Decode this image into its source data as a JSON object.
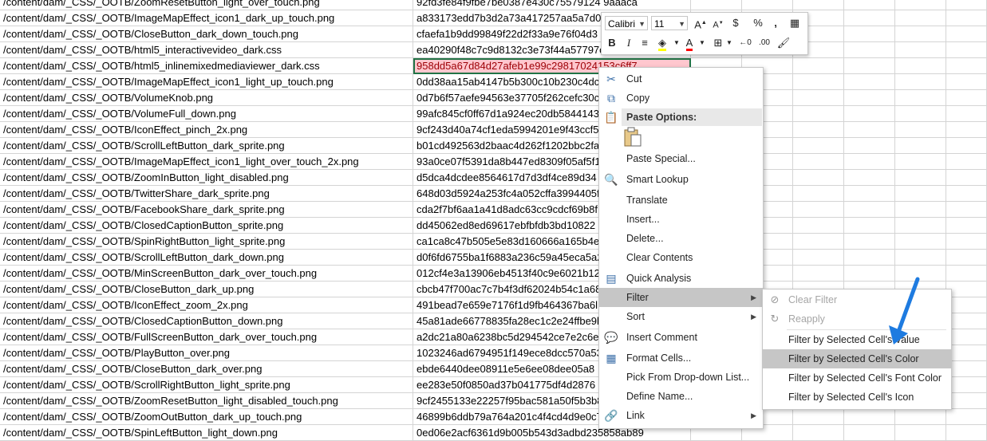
{
  "rows": [
    {
      "path": "/content/dam/_CSS/_OOTB/ZoomResetButton_light_over_touch.png",
      "hash": "92fd3fe84f9fbe7be0387e430c75579124 9aaaca"
    },
    {
      "path": "/content/dam/_CSS/_OOTB/ImageMapEffect_icon1_dark_up_touch.png",
      "hash": "a833173edd7b3d2a73a417257aa5a7d0"
    },
    {
      "path": "/content/dam/_CSS/_OOTB/CloseButton_dark_down_touch.png",
      "hash": "cfaefa1b9dd99849f22d2f33a9e76f04d3"
    },
    {
      "path": "/content/dam/_CSS/_OOTB/html5_interactivevideo_dark.css",
      "hash": "ea40290f48c7c9d8132c3e73f44a57797c"
    },
    {
      "path": "/content/dam/_CSS/_OOTB/html5_inlinemixedmediaviewer_dark.css",
      "hash": "958dd5a67d84d27afeb1e99c29817024153c6ff7"
    },
    {
      "path": "/content/dam/_CSS/_OOTB/ImageMapEffect_icon1_light_up_touch.png",
      "hash": "0dd38aa15ab4147b5b300c10b230c4dc"
    },
    {
      "path": "/content/dam/_CSS/_OOTB/VolumeKnob.png",
      "hash": "0d7b6f57aefe94563e37705f262cefc30c"
    },
    {
      "path": "/content/dam/_CSS/_OOTB/VolumeFull_down.png",
      "hash": "99afc845cf0ff67d1a924ec20db58441437"
    },
    {
      "path": "/content/dam/_CSS/_OOTB/IconEffect_pinch_2x.png",
      "hash": "9cf243d40a74cf1eda5994201e9f43ccf5"
    },
    {
      "path": "/content/dam/_CSS/_OOTB/ScrollLeftButton_dark_sprite.png",
      "hash": "b01cd492563d2baac4d262f1202bbc2fa"
    },
    {
      "path": "/content/dam/_CSS/_OOTB/ImageMapEffect_icon1_light_over_touch_2x.png",
      "hash": "93a0ce07f5391da8b447ed8309f05af5f1"
    },
    {
      "path": "/content/dam/_CSS/_OOTB/ZoomInButton_light_disabled.png",
      "hash": "d5dca4dcdee8564617d7d3df4ce89d34"
    },
    {
      "path": "/content/dam/_CSS/_OOTB/TwitterShare_dark_sprite.png",
      "hash": "648d03d5924a253fc4a052cffa3994405f"
    },
    {
      "path": "/content/dam/_CSS/_OOTB/FacebookShare_dark_sprite.png",
      "hash": "cda2f7bf6aa1a41d8adc63cc9cdcf69b8f"
    },
    {
      "path": "/content/dam/_CSS/_OOTB/ClosedCaptionButton_sprite.png",
      "hash": "dd45062ed8ed69617ebfbfdb3bd10822"
    },
    {
      "path": "/content/dam/_CSS/_OOTB/SpinRightButton_light_sprite.png",
      "hash": "ca1ca8c47b505e5e83d160666a165b4e8"
    },
    {
      "path": "/content/dam/_CSS/_OOTB/ScrollLeftButton_dark_down.png",
      "hash": "d0f6fd6755ba1f6883a236c59a45eca5a2"
    },
    {
      "path": "/content/dam/_CSS/_OOTB/MinScreenButton_dark_over_touch.png",
      "hash": "012cf4e3a13906eb4513f40c9e6021b12"
    },
    {
      "path": "/content/dam/_CSS/_OOTB/CloseButton_dark_up.png",
      "hash": "cbcb47f700ac7c7b4f3df62024b54c1a68"
    },
    {
      "path": "/content/dam/_CSS/_OOTB/IconEffect_zoom_2x.png",
      "hash": "491bead7e659e7176f1d9fb464367ba6l"
    },
    {
      "path": "/content/dam/_CSS/_OOTB/ClosedCaptionButton_down.png",
      "hash": "45a81ade66778835fa28ec1c2e24ffbe9b"
    },
    {
      "path": "/content/dam/_CSS/_OOTB/FullScreenButton_dark_over_touch.png",
      "hash": "a2dc21a80a6238bc5d294542ce7e2c6ec"
    },
    {
      "path": "/content/dam/_CSS/_OOTB/PlayButton_over.png",
      "hash": "1023246ad6794951f149ece8dcc570a53"
    },
    {
      "path": "/content/dam/_CSS/_OOTB/CloseButton_dark_over.png",
      "hash": "ebde6440dee08911e5e6ee08dee05a8"
    },
    {
      "path": "/content/dam/_CSS/_OOTB/ScrollRightButton_light_sprite.png",
      "hash": "ee283e50f0850ad37b041775df4d2876"
    },
    {
      "path": "/content/dam/_CSS/_OOTB/ZoomResetButton_light_disabled_touch.png",
      "hash": "9cf2455133e22257f95bac581a50f5b3b8"
    },
    {
      "path": "/content/dam/_CSS/_OOTB/ZoomOutButton_dark_up_touch.png",
      "hash": "46899b6ddb79a764a201c4f4cd4d9e0c7"
    },
    {
      "path": "/content/dam/_CSS/_OOTB/SpinLeftButton_light_down.png",
      "hash": "0ed06e2acf6361d9b005b543d3adbd235858ab89"
    }
  ],
  "mini_toolbar": {
    "font_name": "Calibri",
    "font_size": "11",
    "bold": "B",
    "italic": "I",
    "percent": "%",
    "comma": ",",
    "currency": "$"
  },
  "context_menu": {
    "cut": "Cut",
    "copy": "Copy",
    "paste_options": "Paste Options:",
    "paste_special": "Paste Special...",
    "smart_lookup": "Smart Lookup",
    "translate": "Translate",
    "insert": "Insert...",
    "delete": "Delete...",
    "clear_contents": "Clear Contents",
    "quick_analysis": "Quick Analysis",
    "filter": "Filter",
    "sort": "Sort",
    "insert_comment": "Insert Comment",
    "format_cells": "Format Cells...",
    "pick_dropdown": "Pick From Drop-down List...",
    "define_name": "Define Name...",
    "link": "Link"
  },
  "filter_submenu": {
    "clear_filter": "Clear Filter",
    "reapply": "Reapply",
    "by_value": "Filter by Selected Cell's Value",
    "by_color": "Filter by Selected Cell's Color",
    "by_font_color": "Filter by Selected Cell's Font Color",
    "by_icon": "Filter by Selected Cell's Icon"
  },
  "colors": {
    "selected_fill": "#ffc7ce",
    "selected_text": "#9c0006",
    "arrow": "#1e7be0"
  }
}
